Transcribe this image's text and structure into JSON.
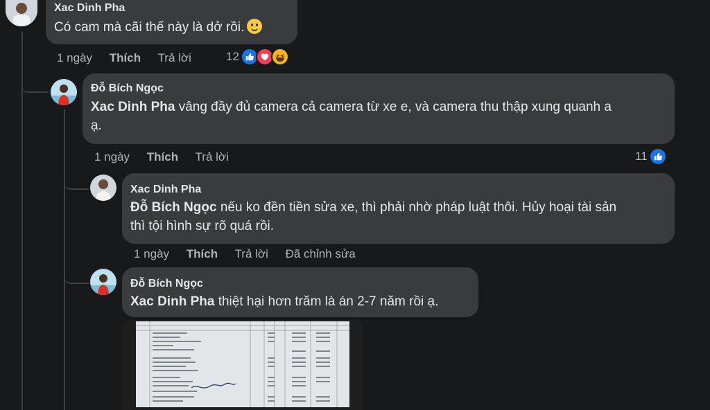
{
  "comments": [
    {
      "author": "Xac Dinh Pha",
      "text": "Có cam mà cãi thế này là dở rồi.",
      "emoji": "slightly-smiling-face",
      "time": "1 ngày",
      "like": "Thích",
      "reply": "Trả lời",
      "reaction_count": "12",
      "reactions": [
        "like-icon",
        "love-icon",
        "haha-icon"
      ]
    },
    {
      "author": "Đỗ Bích Ngọc",
      "mention": "Xac Dinh Pha",
      "text_line1": " vâng đầy đủ camera cả camera từ xe e, và camera thu thập xung quanh a",
      "text_line2": "ạ.",
      "time": "1 ngày",
      "like": "Thích",
      "reply": "Trả lời",
      "reaction_count": "11",
      "reactions": [
        "like-icon"
      ]
    },
    {
      "author": "Xac Dinh Pha",
      "mention": "Đỗ Bích Ngọc",
      "text_line1": " nếu ko đền tiền sửa xe, thì phải nhờ pháp luật thôi. Hủy hoại tài sản",
      "text_line2": "thì tội hình sự rõ quá rồi.",
      "time": "1 ngày",
      "like": "Thích",
      "reply": "Trả lời",
      "edited": "Đã chỉnh sửa"
    },
    {
      "author": "Đỗ Bích Ngọc",
      "mention": "Xac Dinh Pha",
      "text": " thiệt hại hơn trăm là án 2-7 năm rồi ạ.",
      "attachment": "photo"
    }
  ],
  "colors": {
    "background": "#18191a",
    "bubble": "#3a3b3c",
    "text": "#e4e6eb",
    "secondary": "#b0b3b8",
    "like": "#1b74e4",
    "love": "#f33e58",
    "haha": "#f7b125"
  }
}
